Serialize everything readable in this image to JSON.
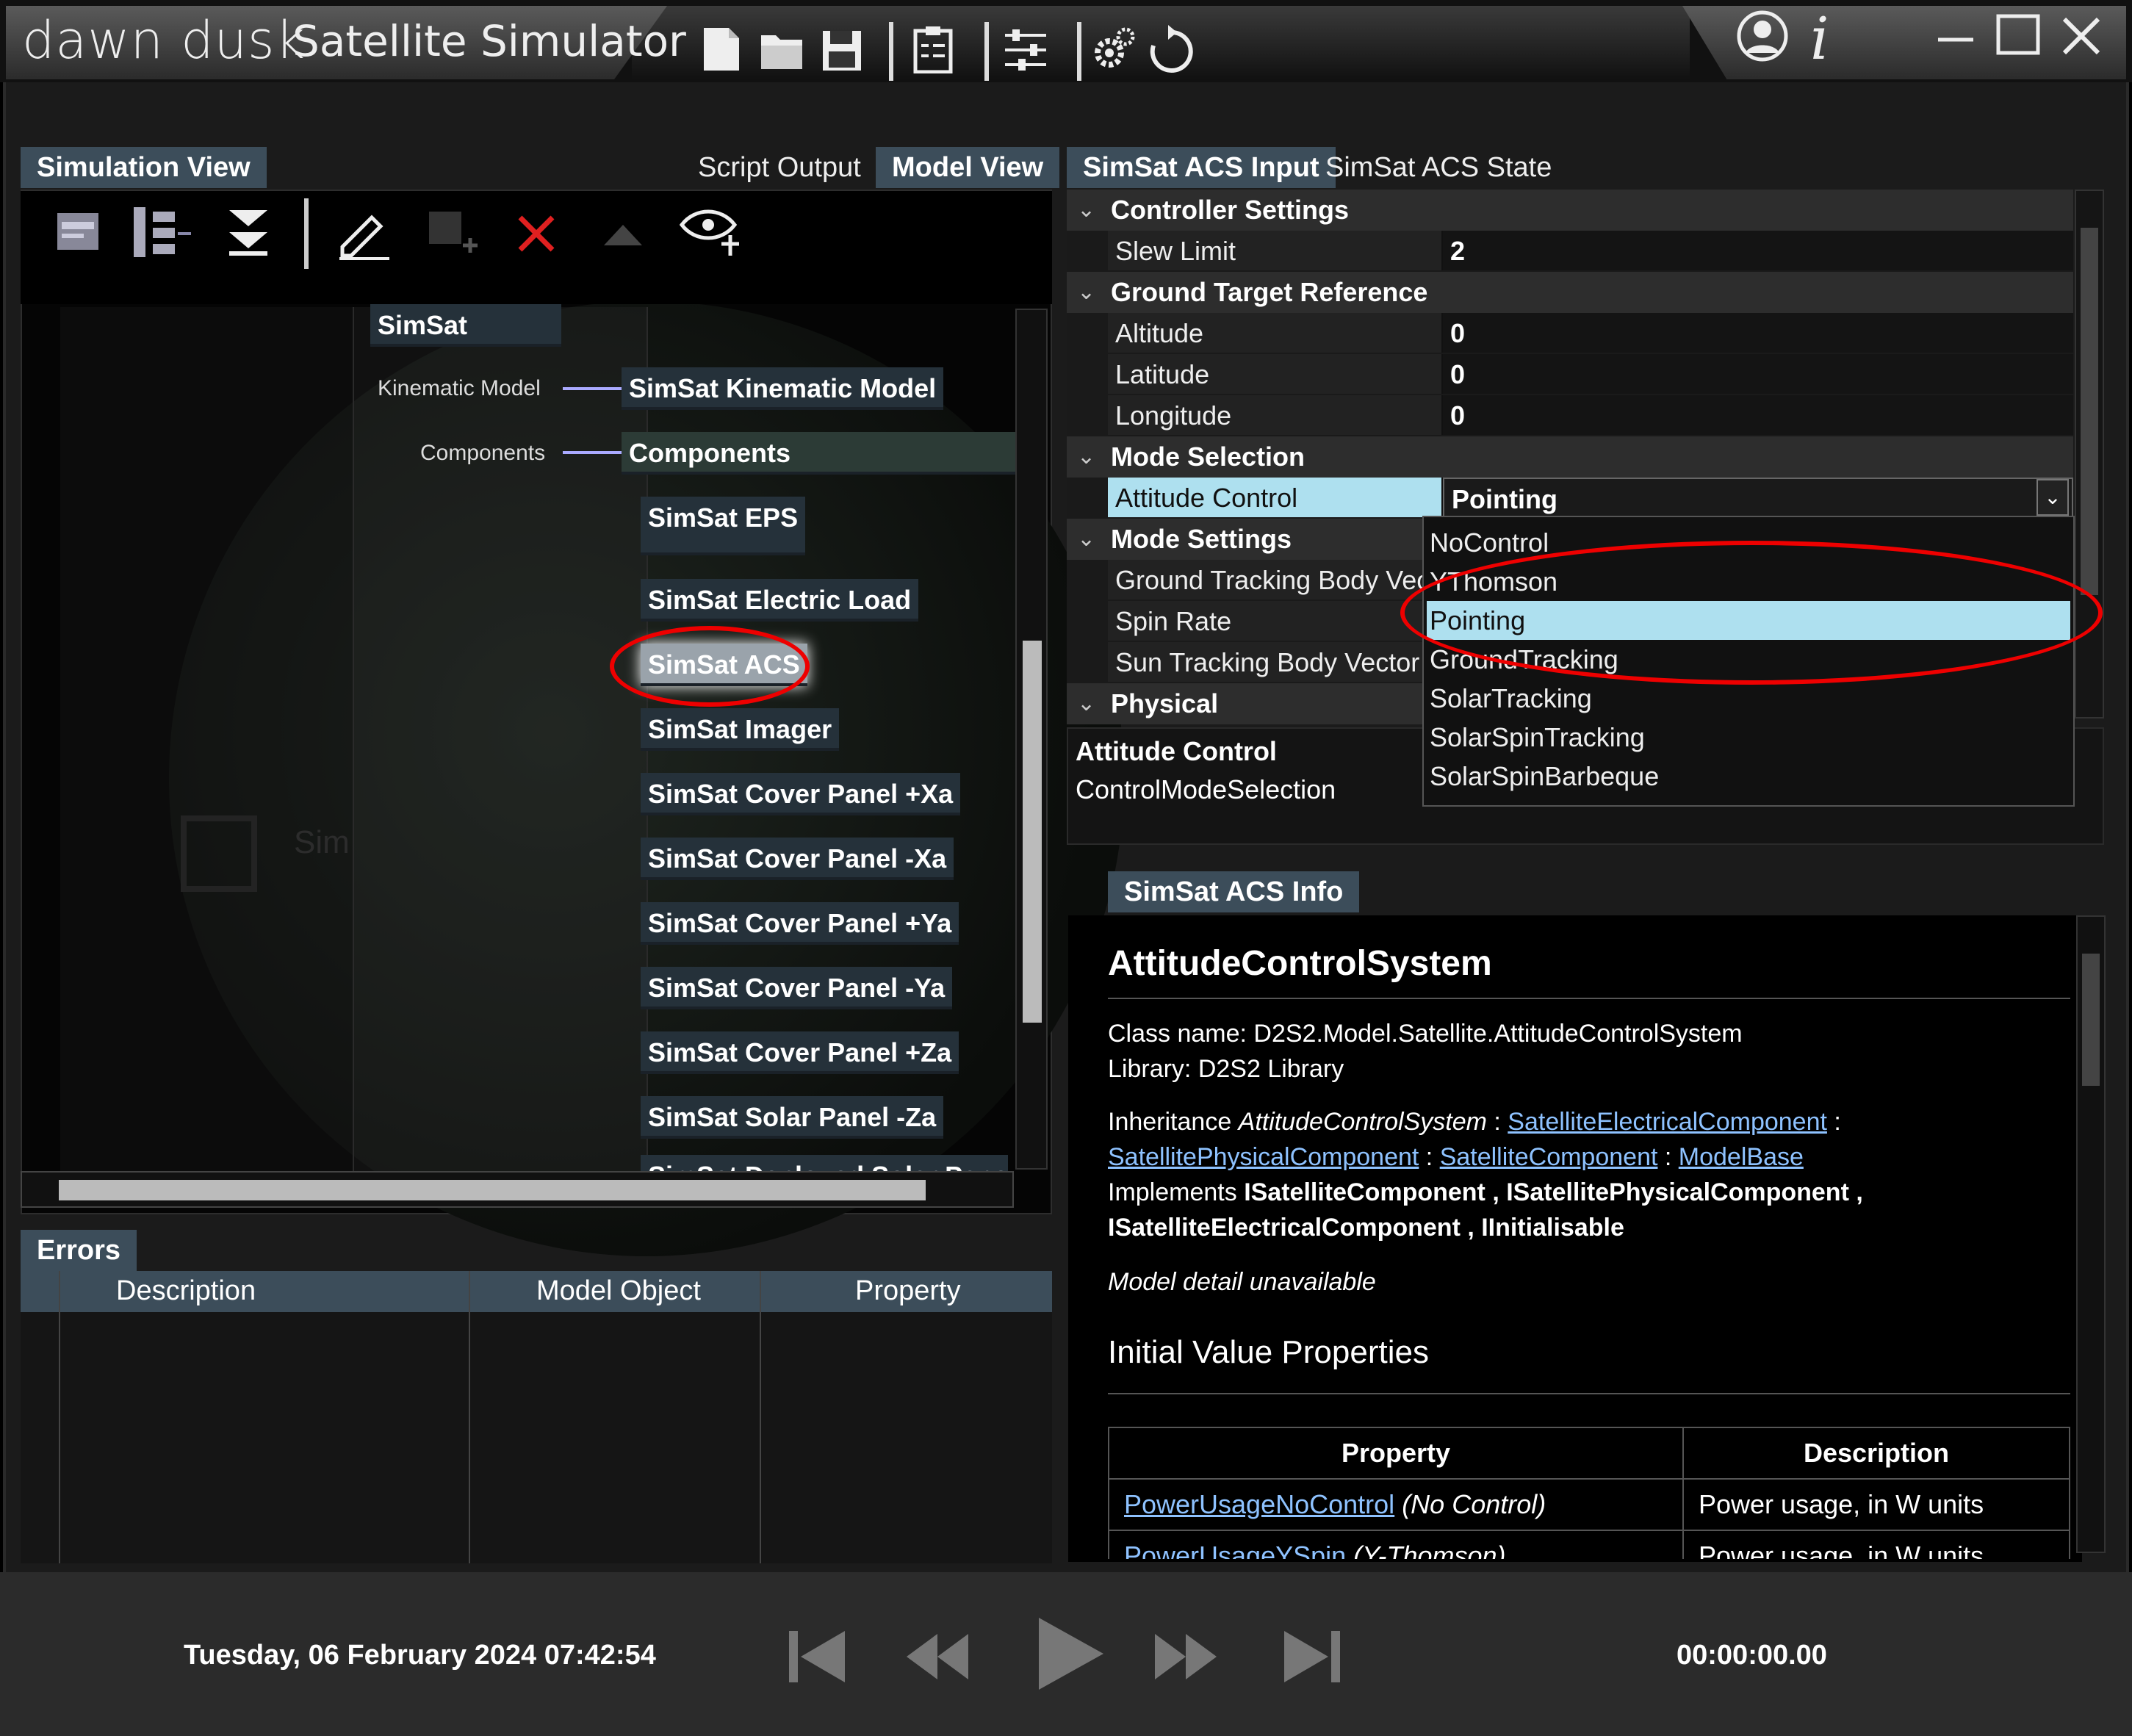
{
  "app": {
    "logo_text": "dawn dusk",
    "title": "Satellite Simulator"
  },
  "toolbar": {
    "icons": [
      "new-file-icon",
      "open-folder-icon",
      "save-icon",
      "clipboard-icon",
      "sliders-icon",
      "gear-icon",
      "refresh-icon"
    ],
    "right_icons": [
      "user-icon",
      "info-icon",
      "minimize-icon",
      "maximize-icon",
      "close-icon"
    ]
  },
  "left_panel": {
    "tabs": [
      {
        "label": "Simulation View",
        "active": true
      },
      {
        "label": "Script Output",
        "active": false
      },
      {
        "label": "Model View",
        "active": true
      }
    ],
    "tools": [
      "window-icon",
      "tree-icon",
      "expand-all-icon",
      "edit-icon",
      "add-node-icon",
      "delete-icon",
      "move-up-icon",
      "view-add-icon"
    ],
    "tree": {
      "root": "SimSat",
      "kinematic_label": "Kinematic Model",
      "kinematic_node": "SimSat Kinematic Model",
      "components_label": "Components",
      "components_node": "Components",
      "components": [
        "SimSat EPS",
        "SimSat Electric Load",
        "SimSat ACS",
        "SimSat Imager",
        "SimSat Cover Panel +Xa",
        "SimSat Cover Panel -Xa",
        "SimSat Cover Panel +Ya",
        "SimSat Cover Panel -Ya",
        "SimSat Cover Panel +Za",
        "SimSat Solar Panel -Za",
        "SimSat Deployed Solar Panel +"
      ],
      "background_label": "Sim"
    }
  },
  "errors": {
    "tab": "Errors",
    "columns": [
      "Description",
      "Model Object",
      "Property"
    ]
  },
  "right_panel": {
    "tabs": [
      {
        "label": "SimSat ACS Input",
        "active": true
      },
      {
        "label": "SimSat ACS State",
        "active": false
      }
    ],
    "grid": {
      "controller_settings": "Controller Settings",
      "slew_limit_name": "Slew Limit",
      "slew_limit_value": "2",
      "ground_target": "Ground Target Reference",
      "altitude_name": "Altitude",
      "altitude_value": "0",
      "latitude_name": "Latitude",
      "latitude_value": "0",
      "longitude_name": "Longitude",
      "longitude_value": "0",
      "mode_selection": "Mode Selection",
      "attitude_control_name": "Attitude Control",
      "attitude_control_value": "Pointing",
      "mode_settings": "Mode Settings",
      "ground_tracking_name": "Ground Tracking Body Vec",
      "spin_rate_name": "Spin Rate",
      "sun_tracking_name": "Sun Tracking Body Vector",
      "physical": "Physical"
    },
    "dropdown_options": [
      "NoControl",
      "YThomson",
      "Pointing",
      "GroundTracking",
      "SolarTracking",
      "SolarSpinTracking",
      "SolarSpinBarbeque"
    ],
    "dropdown_selected": "Pointing",
    "description": {
      "title": "Attitude Control",
      "text": "ControlModeSelection"
    },
    "info_tab": "SimSat ACS Info",
    "info": {
      "heading": "AttitudeControlSystem",
      "class_name": "Class name: D2S2.Model.Satellite.AttitudeControlSystem",
      "library": "Library: D2S2 Library",
      "inheritance_prefix": "Inheritance ",
      "inheritance_class": "AttitudeControlSystem",
      "sep": " : ",
      "link1": "SatelliteElectricalComponent",
      "link2": "SatellitePhysicalComponent",
      "link3": "SatelliteComponent",
      "link4": "ModelBase",
      "implements_prefix": "Implements ",
      "implements_list": "ISatelliteComponent , ISatellitePhysicalComponent ,",
      "implements_list2": "ISatelliteElectricalComponent , IInitialisable",
      "model_detail": "Model detail unavailable",
      "ivp_heading": "Initial Value Properties",
      "table_headers": [
        "Property",
        "Description"
      ],
      "rows": [
        {
          "property": "PowerUsageNoControl",
          "mode": " (No Control)",
          "description": "Power usage, in W units"
        },
        {
          "property": "PowerUsageYSpin",
          "mode": " (Y-Thomson)",
          "description": "Power usage, in W units"
        }
      ]
    }
  },
  "transport": {
    "datetime": "Tuesday, 06 February 2024 07:42:54",
    "elapsed": "00:00:00.00",
    "buttons": [
      "skip-start-icon",
      "rewind-icon",
      "play-icon",
      "fast-forward-icon",
      "skip-end-icon"
    ]
  },
  "colors": {
    "accent_tab": "#3c4d5a",
    "selected_row": "#aee0ef",
    "annotation": "#e00000"
  }
}
